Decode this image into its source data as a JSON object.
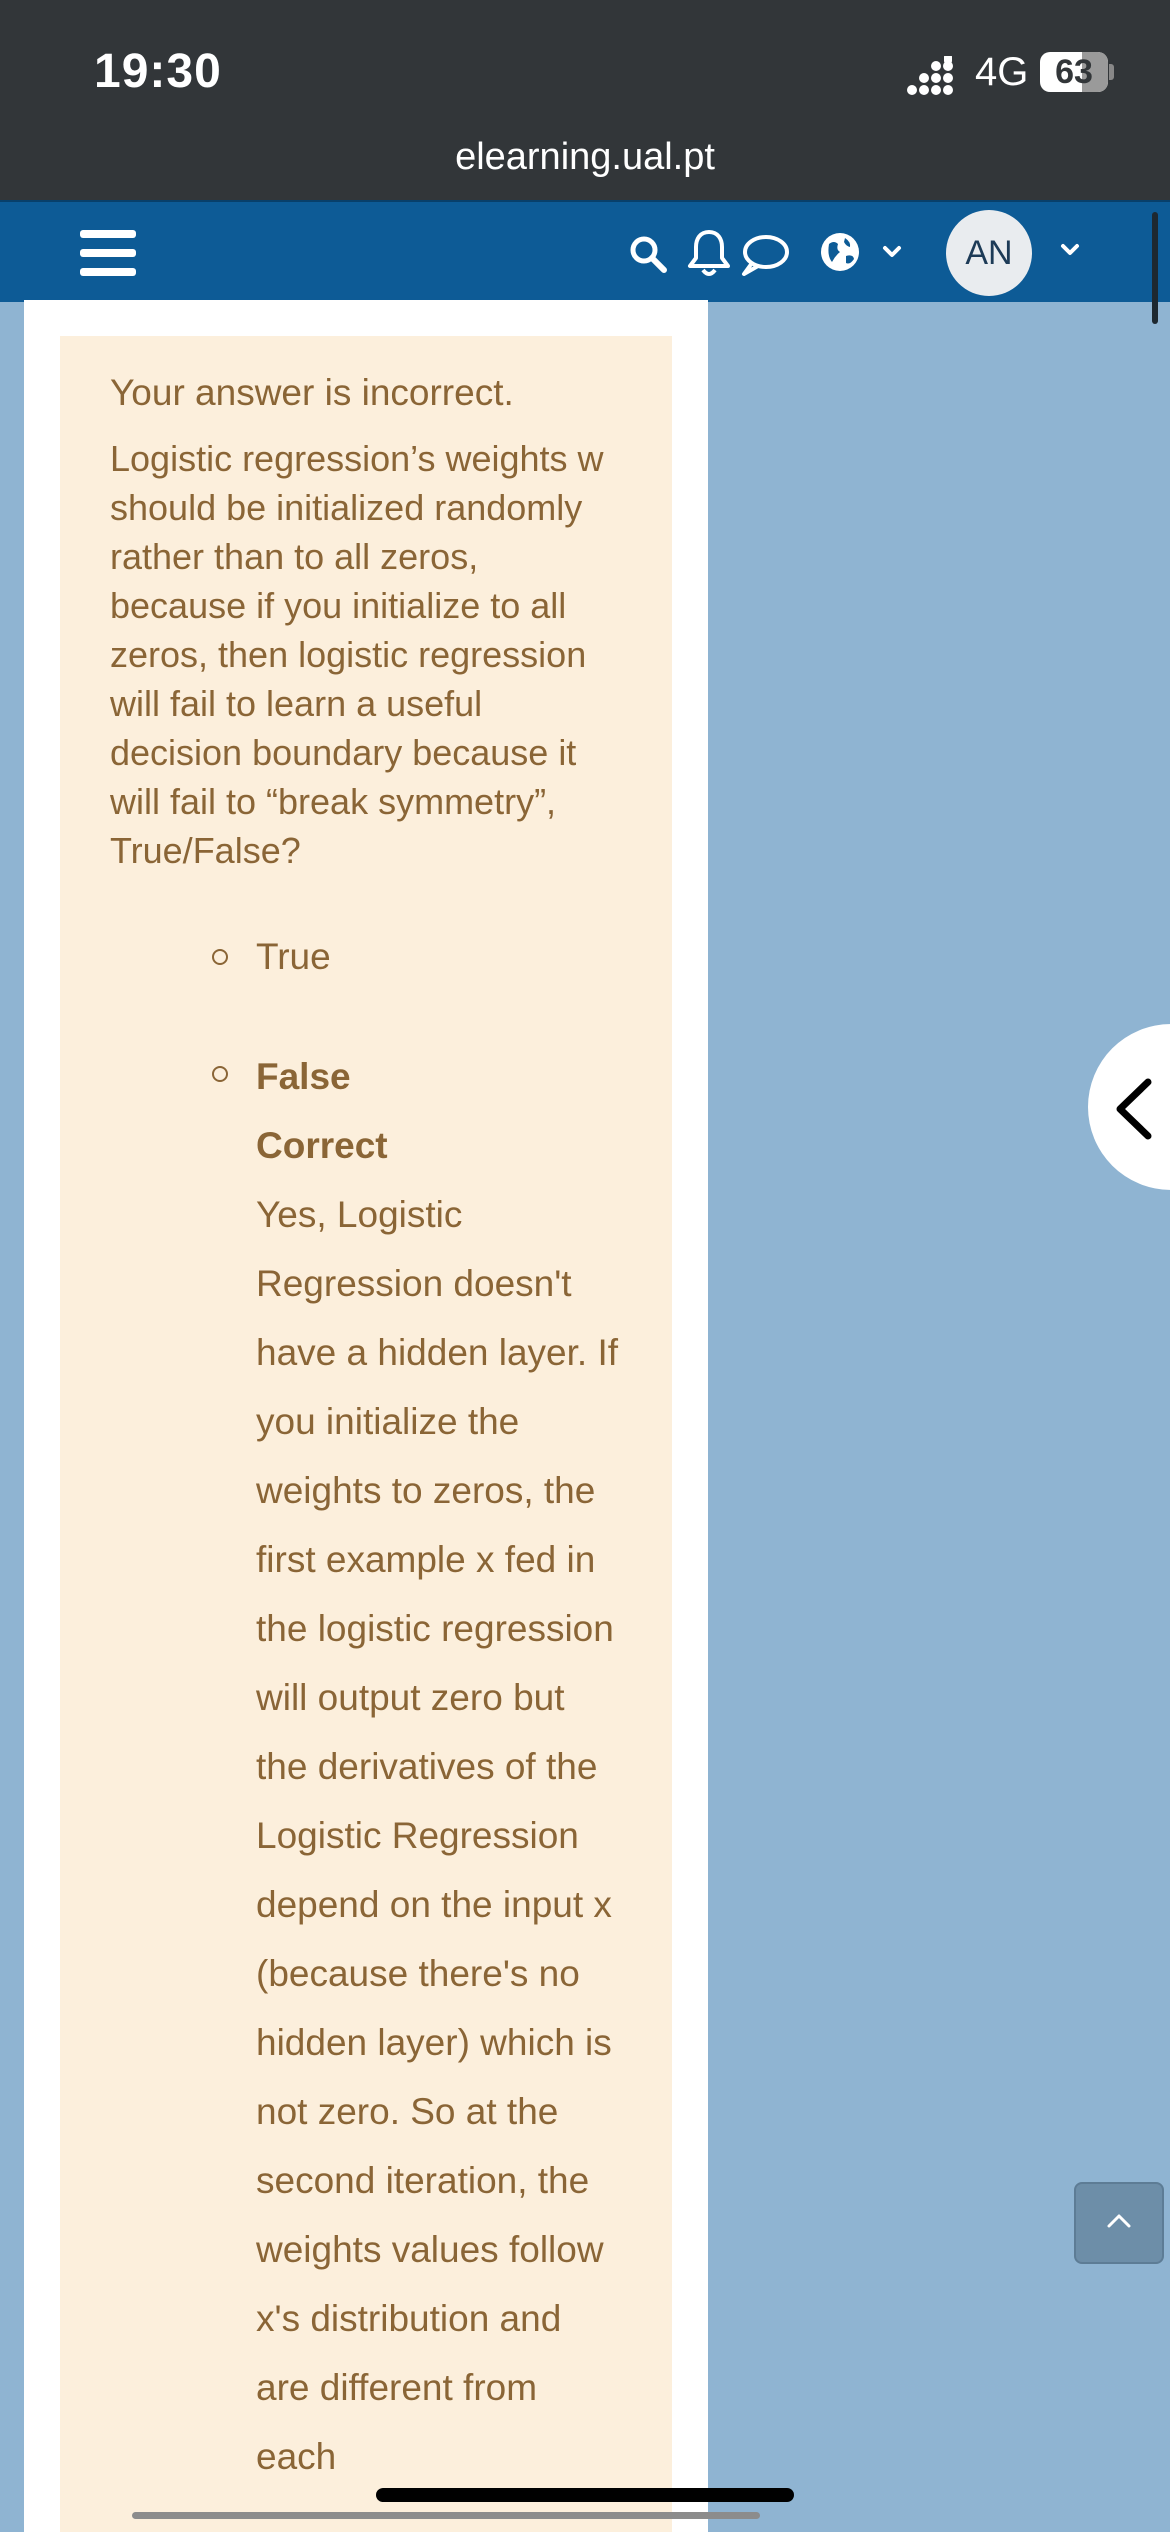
{
  "status_bar": {
    "time": "19:30",
    "network": "4G",
    "battery": "63"
  },
  "browser": {
    "url": "elearning.ual.pt"
  },
  "navbar": {
    "avatar_initials": "AN"
  },
  "feedback": {
    "result": "Your answer is incorrect.",
    "question": "Logistic regression’s weights w should be initialized randomly rather than to all zeros, because if you initialize to all zeros, then logistic regression will fail to learn a useful decision boundary because it will fail to “break symmetry”, True/False?",
    "options": [
      {
        "label": "True"
      },
      {
        "label": "False",
        "status": "Correct",
        "explanation": "Yes, Logistic Regression doesn't have a hidden layer. If you initialize the weights to zeros, the first example x fed in the logistic regression will output zero but the derivatives of the Logistic Regression depend on the input x (because there's no hidden layer) which is not zero. So at the second iteration, the weights values follow x's distribution and are different from each"
      }
    ]
  },
  "colors": {
    "status_bar_bg": "#323639",
    "navbar_bg": "#0d5b96",
    "page_bg": "#8fb4d2",
    "feedback_bg": "#fcefdc",
    "feedback_text": "#8a6536"
  },
  "icons": [
    "signal-icon",
    "hamburger-icon",
    "search-icon",
    "bell-icon",
    "chat-icon",
    "globe-icon",
    "chevron-down-icon",
    "chevron-left-icon",
    "chevron-up-icon"
  ]
}
